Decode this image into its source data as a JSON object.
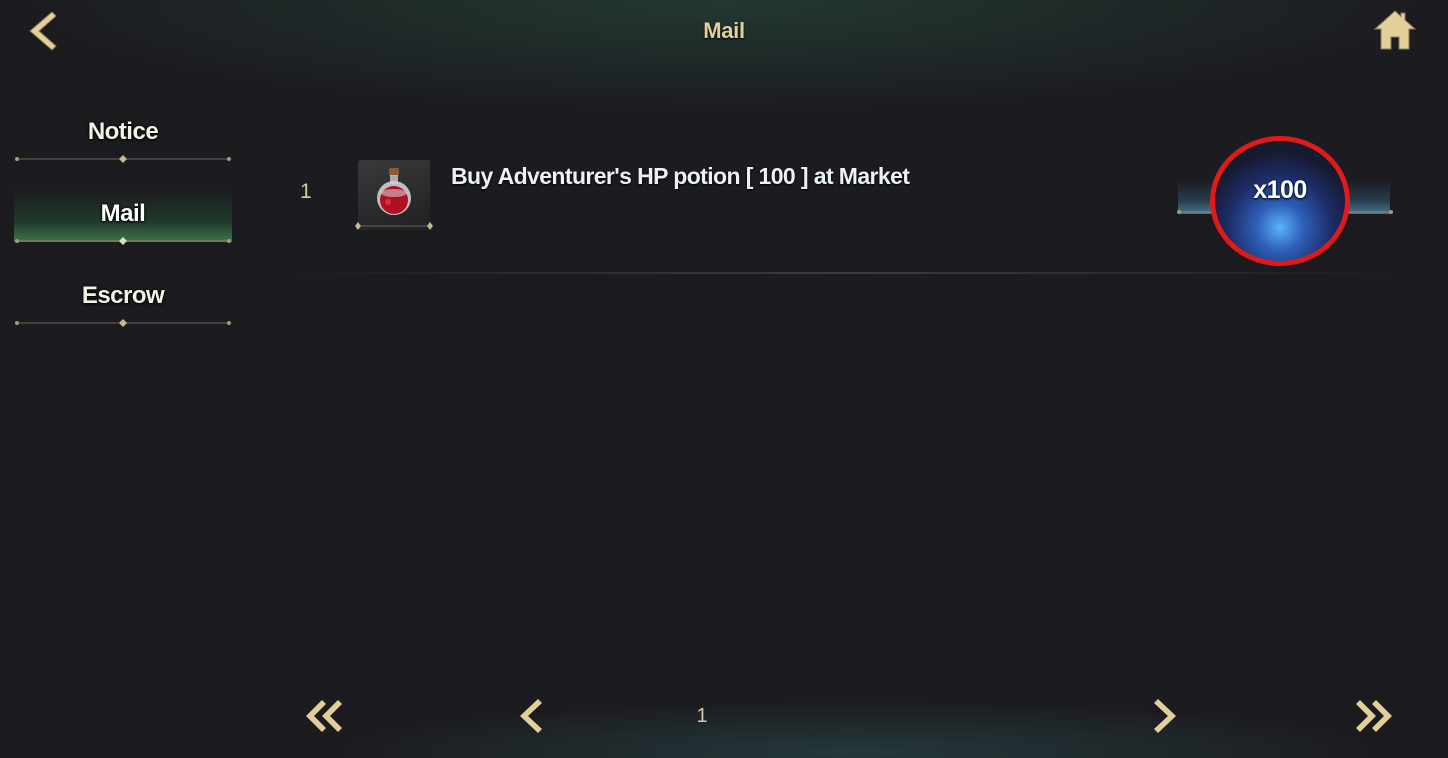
{
  "header": {
    "title": "Mail",
    "back_icon": "chevron-left-icon",
    "home_icon": "home-icon"
  },
  "sidebar": {
    "items": [
      {
        "label": "Notice",
        "active": false
      },
      {
        "label": "Mail",
        "active": true
      },
      {
        "label": "Escrow",
        "active": false
      }
    ]
  },
  "mail_list": {
    "rows": [
      {
        "index": "1",
        "item_icon": "red-potion-icon",
        "text": "Buy Adventurer's HP potion [ 100 ] at Market",
        "quantity": "x100"
      }
    ]
  },
  "pagination": {
    "current_page": "1",
    "first_icon": "double-chevron-left-icon",
    "prev_icon": "chevron-left-icon",
    "next_icon": "chevron-right-icon",
    "last_icon": "double-chevron-right-icon"
  },
  "colors": {
    "background": "#1c1c20",
    "gold_accent": "#e3cf9a",
    "highlight_circle": "#e01a1a",
    "active_tab_glow": "#5abe6e",
    "claim_glow": "#59b2ff"
  }
}
